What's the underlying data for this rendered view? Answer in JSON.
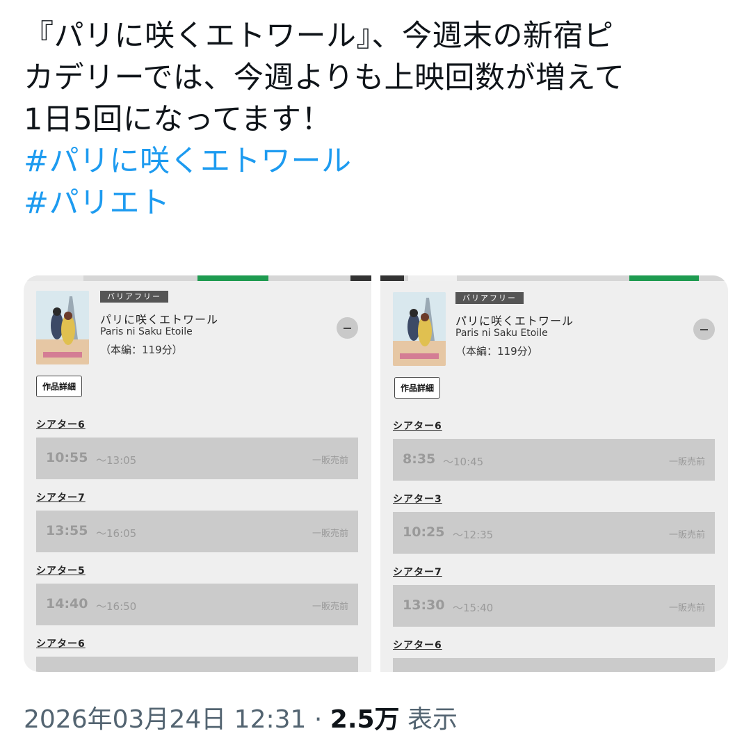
{
  "tweet": {
    "lines": [
      "『パリに咲くエトワール』、今週末の新宿ピ",
      "カデリーでは、今週よりも上映回数が増えて",
      "1日5回になってます！"
    ],
    "hashtags": [
      "#パリに咲くエトワール",
      "#パリエト"
    ]
  },
  "colors": {
    "accent": "#1d9bf0",
    "tab_active": "#1e9b50"
  },
  "screenshots": [
    {
      "barrier_free": "バリアフリー",
      "title_jp": "パリに咲くエトワール",
      "title_en": "Paris ni Saku Etoile",
      "runtime": "（本編：119分）",
      "detail_button": "作品詳細",
      "collapse_icon": "minus-circle-icon",
      "showings": [
        {
          "theater": "シアター6",
          "start": "10:55",
          "end": "〜13:05",
          "status": "一販売前"
        },
        {
          "theater": "シアター7",
          "start": "13:55",
          "end": "〜16:05",
          "status": "一販売前"
        },
        {
          "theater": "シアター5",
          "start": "14:40",
          "end": "〜16:50",
          "status": "一販売前"
        },
        {
          "theater": "シアター6",
          "start": "",
          "end": "",
          "status": ""
        }
      ]
    },
    {
      "barrier_free": "バリアフリー",
      "title_jp": "パリに咲くエトワール",
      "title_en": "Paris ni Saku Etoile",
      "runtime": "（本編：119分）",
      "detail_button": "作品詳細",
      "collapse_icon": "minus-circle-icon",
      "showings": [
        {
          "theater": "シアター6",
          "start": "8:35",
          "end": "〜10:45",
          "status": "一販売前"
        },
        {
          "theater": "シアター3",
          "start": "10:25",
          "end": "〜12:35",
          "status": "一販売前"
        },
        {
          "theater": "シアター7",
          "start": "13:30",
          "end": "〜15:40",
          "status": "一販売前"
        },
        {
          "theater": "シアター6",
          "start": "",
          "end": "",
          "status": ""
        }
      ]
    }
  ],
  "meta": {
    "datetime": "2026年03月24日 12:31",
    "separator": " · ",
    "views_count": "2.5万",
    "views_label": " 表示"
  }
}
